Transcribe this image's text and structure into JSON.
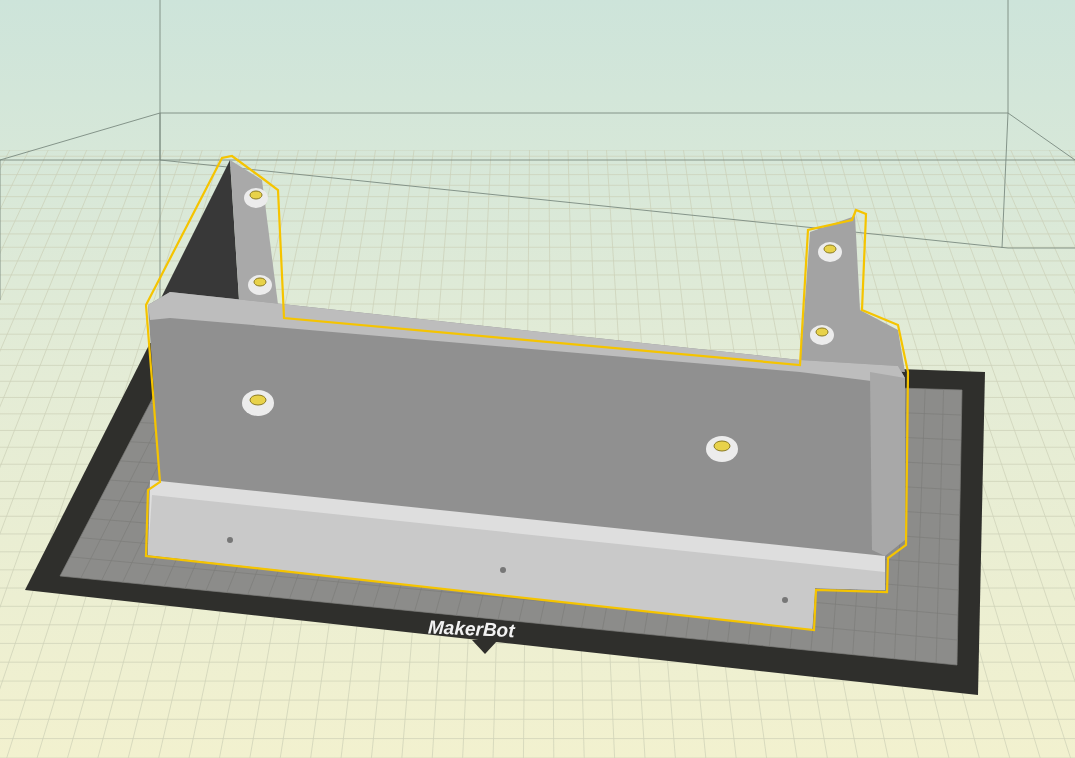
{
  "viewport": {
    "build_plate": {
      "logo": "MakerBot"
    },
    "model": {
      "selected": true
    }
  }
}
